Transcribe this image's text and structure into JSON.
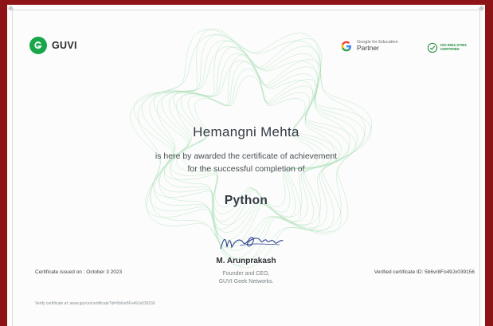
{
  "brand": {
    "name": "GUVI",
    "color": "#19a64a"
  },
  "partner": {
    "line1": "Google for Education",
    "line2": "Partner"
  },
  "iso": {
    "line1": "ISO 9001:27001",
    "line2": "CERTIFIED"
  },
  "recipient": {
    "name": "Hemangni Mehta"
  },
  "award": {
    "line1": "is here by awarded the certificate of achievement",
    "line2": "for the successful completion of"
  },
  "course": {
    "name": "Python"
  },
  "signatory": {
    "name": "M. Arunprakash",
    "role_line1": "Founder and CEO,",
    "role_line2": "GUVI Geek Networks."
  },
  "issued": {
    "text": "Certificate issued on : October 3 2023"
  },
  "verification": {
    "id_text": "Verified certificate ID: 5b6vr8Fo49Jx039156",
    "url_text": "Verify certificate at: www.guvi.in/certificate?id=5b6vr8Fo49Jx039156"
  },
  "colors": {
    "frame": "#8e1316",
    "paper": "#fbfcfb",
    "guilloche": "#8fd6a0"
  }
}
